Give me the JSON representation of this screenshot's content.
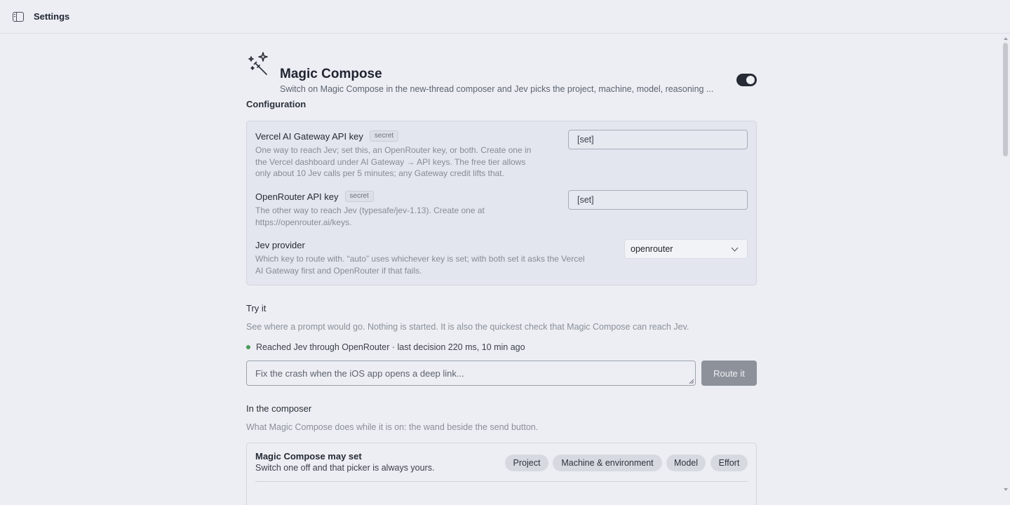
{
  "topbar": {
    "title": "Settings"
  },
  "hero": {
    "title": "Magic Compose",
    "description": "Switch on Magic Compose in the new-thread composer and Jev picks the project, machine, model, reasoning ...",
    "enabled": true
  },
  "configuration": {
    "title": "Configuration",
    "fields": [
      {
        "label": "Vercel AI Gateway API key",
        "badge": "secret",
        "help_lines": [
          "One way to reach Jev; set this, an OpenRouter key, or both. Create one in",
          "the Vercel dashboard under AI Gateway → API keys. The free tier allows",
          "only about 10 Jev calls per 5 minutes; any Gateway credit lifts that."
        ],
        "value": "[set]"
      },
      {
        "label": "OpenRouter API key",
        "badge": "secret",
        "help_lines": [
          "The other way to reach Jev (typesafe/jev-1.13). Create one at",
          "https://openrouter.ai/keys."
        ],
        "value": "[set]"
      },
      {
        "label": "Jev provider",
        "help_lines": [
          "Which key to route with. “auto” uses whichever key is set; with both set it asks the Vercel",
          "AI Gateway first and OpenRouter if that fails."
        ],
        "selected": "openrouter"
      }
    ]
  },
  "try_it": {
    "title": "Try it",
    "description": "See where a prompt would go. Nothing is started. It is also the quickest check that Magic Compose can reach Jev.",
    "status": "Reached Jev through OpenRouter · last decision 220 ms, 10 min ago",
    "status_color": "#4a9b58",
    "placeholder": "Fix the crash when the iOS app opens a deep link...",
    "button": "Route it"
  },
  "composer": {
    "title": "In the composer",
    "description": "What Magic Compose does while it is on: the wand beside the send button.",
    "may_set": {
      "title": "Magic Compose may set",
      "help": "Switch one off and that picker is always yours.",
      "chips": [
        "Project",
        "Machine & environment",
        "Model",
        "Effort"
      ]
    }
  }
}
